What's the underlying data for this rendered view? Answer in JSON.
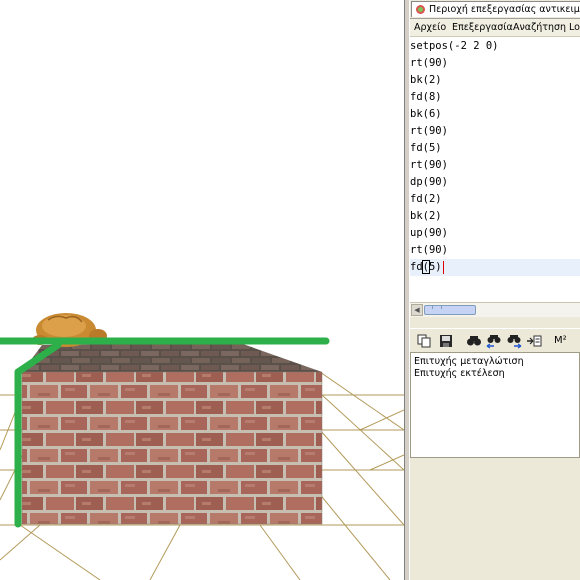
{
  "window": {
    "tab_title": "Περιοχή επεξεργασίας αντικειμένων"
  },
  "menu": {
    "items": [
      "Αρχείο",
      "Επεξεργασία",
      "Αναζήτηση",
      "Lo"
    ]
  },
  "editor": {
    "lines": [
      "setpos(-2 2 0)",
      "rt(90)",
      "bk(2)",
      "fd(8)",
      "bk(6)",
      "rt(90)",
      "fd(5)",
      "rt(90)",
      "dp(90)",
      "fd(2)",
      "bk(2)",
      "up(90)",
      "rt(90)"
    ],
    "current_line": {
      "prefix": "fd",
      "boxed": "(",
      "suffix": "5)"
    }
  },
  "toolbar": {
    "buttons": [
      "copy-icon",
      "save-icon",
      "find-icon",
      "find-previous-icon",
      "find-next-icon",
      "insert-icon",
      "superscript-icon"
    ],
    "superscript_label": "M²"
  },
  "output": {
    "lines": [
      "Επιτυχής μεταγλώτιση",
      "Επιτυχής εκτέλεση"
    ]
  },
  "colors": {
    "green_lines": "#2db04a",
    "wireframe": "#b39a5a",
    "brick": "#a8665a",
    "mortar": "#c9c1b4",
    "turtle_shell": "#c98a32"
  }
}
